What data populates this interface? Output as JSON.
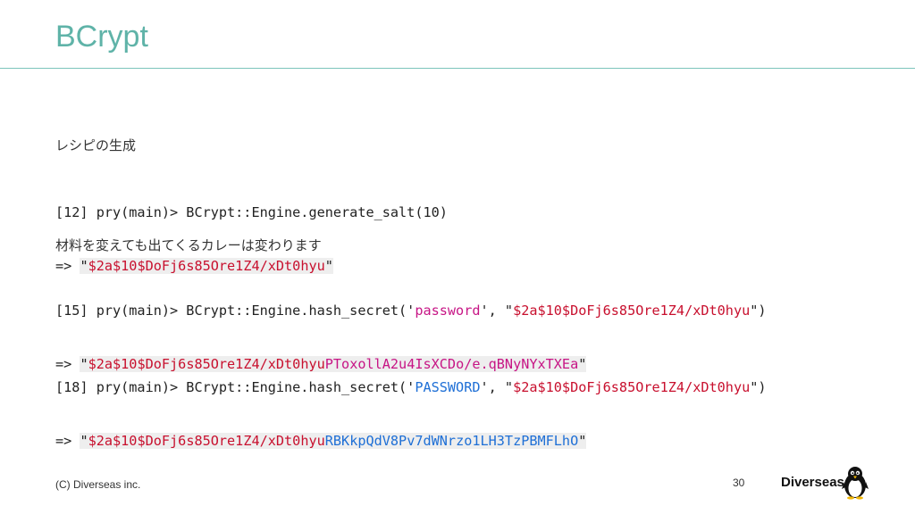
{
  "slide": {
    "title": "BCrypt",
    "footer": "(C) Diverseas inc.",
    "page_number": "30",
    "brand": "Diverseas"
  },
  "section1": {
    "caption": "レシピの生成",
    "line1": "[12] pry(main)> BCrypt::Engine.generate_salt(10)",
    "line2_prefix": "=> ",
    "line2_quote_open": "\"",
    "line2_salt": "$2a$10$DoFj6s85Ore1Z4/xDt0hyu",
    "line2_quote_close": "\""
  },
  "section2": {
    "caption": "材料を変えても出てくるカレーは変わります",
    "line1_prefix": "[15] pry(main)> BCrypt::Engine.hash_secret('",
    "line1_secret": "password",
    "line1_mid": "', \"",
    "line1_salt": "$2a$10$DoFj6s85Ore1Z4/xDt0hyu",
    "line1_suffix": "\")",
    "line2_prefix": "=> ",
    "line2_quote_open": "\"",
    "line2_salt": "$2a$10$DoFj6s85Ore1Z4/xDt0hyu",
    "line2_hash": "PToxollA2u4IsXCDo/e.qBNyNYxTXEa",
    "line2_quote_close": "\""
  },
  "section3": {
    "line1_prefix": "[18] pry(main)> BCrypt::Engine.hash_secret('",
    "line1_secret": "PASSWORD",
    "line1_mid": "', \"",
    "line1_salt": "$2a$10$DoFj6s85Ore1Z4/xDt0hyu",
    "line1_suffix": "\")",
    "line2_prefix": "=> ",
    "line2_quote_open": "\"",
    "line2_salt": "$2a$10$DoFj6s85Ore1Z4/xDt0hyu",
    "line2_hash": "RBKkpQdV8Pv7dWNrzo1LH3TzPBMFLhO",
    "line2_quote_close": "\""
  },
  "colors": {
    "title": "#5fb3a8",
    "salt": "#c8102e",
    "secret_lower": "#c71585",
    "hash": "#1e6fd6"
  },
  "icons": {
    "logo": "penguin-logo-icon"
  }
}
